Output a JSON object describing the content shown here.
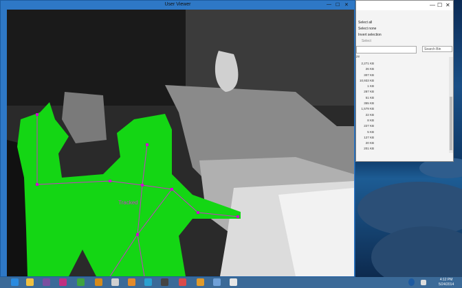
{
  "user_viewer": {
    "title": "User Viewer",
    "skeleton_label": "Tracked",
    "controls": {
      "minimize": "—",
      "maximize": "☐",
      "close": "✕"
    }
  },
  "explorer": {
    "controls": {
      "minimize": "—",
      "maximize": "☐",
      "close": "✕"
    },
    "ribbon": [
      "Select all",
      "Select none",
      "Invert selection",
      "Select"
    ],
    "search_placeholder": "Search Bin",
    "column_header": "ze",
    "sizes": [
      "2,271 KB",
      "26 KB",
      "307 KB",
      "10,933 KB",
      "1 KB",
      "287 KB",
      "51 KB",
      "355 KB",
      "1,579 KB",
      "22 KB",
      "8 KB",
      "227 KB",
      "5 KB",
      "127 KB",
      "20 KB",
      "201 KB"
    ]
  },
  "taskbar": {
    "time": "4:12 PM",
    "date": "5/24/2014"
  },
  "colors": {
    "tracked_user": "#14d614",
    "skeleton": "#cc33cc",
    "joint": "#d000d0"
  }
}
